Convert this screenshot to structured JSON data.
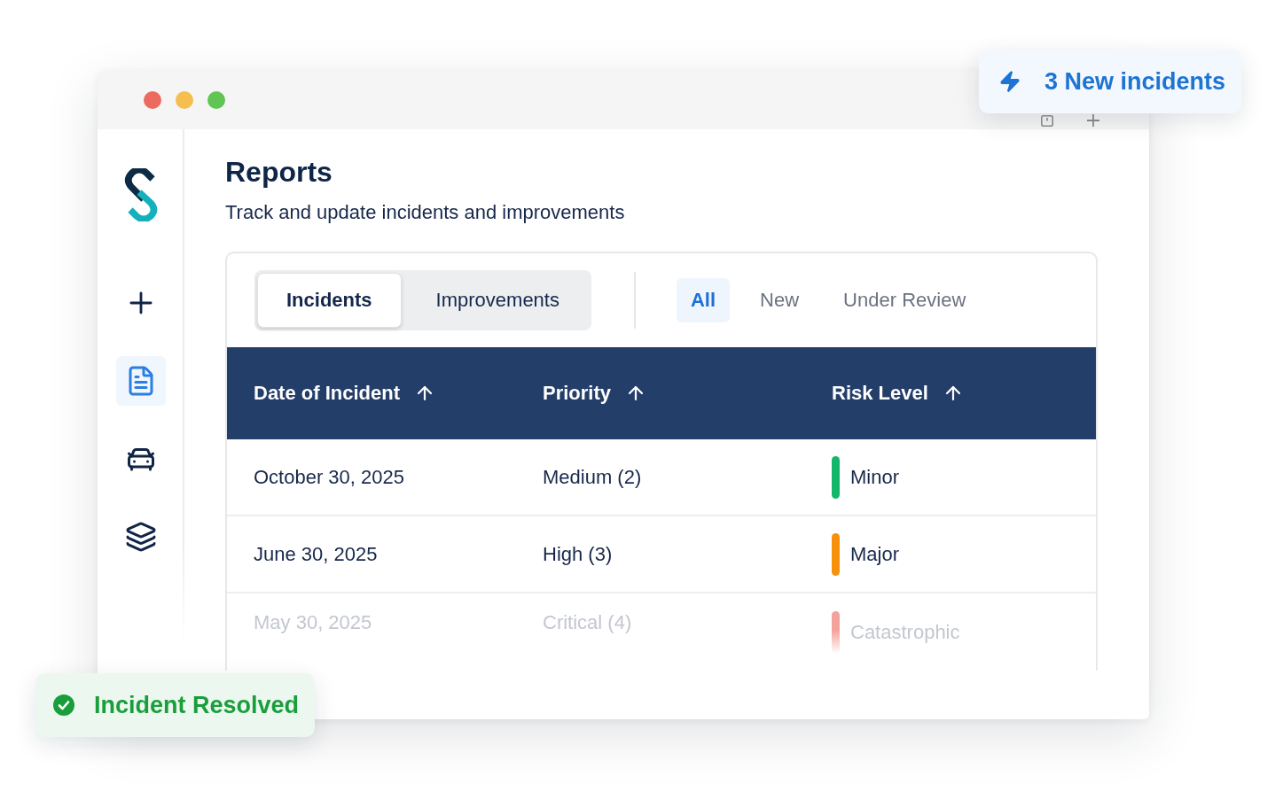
{
  "window": {
    "traffic_lights": [
      {
        "color": "#ed6a5e"
      },
      {
        "color": "#f4bf4f"
      },
      {
        "color": "#61c554"
      }
    ]
  },
  "sidebar": {
    "items": [
      {
        "kind": "add",
        "selected": false
      },
      {
        "kind": "document",
        "selected": true
      },
      {
        "kind": "car",
        "selected": false
      },
      {
        "kind": "layers",
        "selected": false
      }
    ]
  },
  "page": {
    "title": "Reports",
    "subtitle": "Track and update incidents and improvements"
  },
  "tabs": [
    {
      "label": "Incidents",
      "selected": true
    },
    {
      "label": "Improvements",
      "selected": false
    }
  ],
  "filters": [
    {
      "label": "All",
      "selected": true
    },
    {
      "label": "New",
      "selected": false
    },
    {
      "label": "Under Review",
      "selected": false
    }
  ],
  "table": {
    "columns": [
      {
        "label": "Date of Incident",
        "sorted": true
      },
      {
        "label": "Priority",
        "sorted": true
      },
      {
        "label": "Risk Level",
        "sorted": true
      }
    ],
    "rows": [
      {
        "date": "October 30, 2025",
        "priority": "Medium (2)",
        "risk_level": "Minor",
        "color": "#12b76a",
        "dimmed": false
      },
      {
        "date": "June 30, 2025",
        "priority": "High (3)",
        "risk_level": "Major",
        "color": "#f7900a",
        "dimmed": false
      },
      {
        "date": "May 30, 2025",
        "priority": "Critical (4)",
        "risk_level": "Catastrophic",
        "color": "#f4a29c",
        "dimmed": true
      }
    ]
  },
  "notifications": [
    {
      "kind": "info",
      "text": "3 New incidents"
    },
    {
      "kind": "success",
      "text": "Incident Resolved"
    }
  ]
}
